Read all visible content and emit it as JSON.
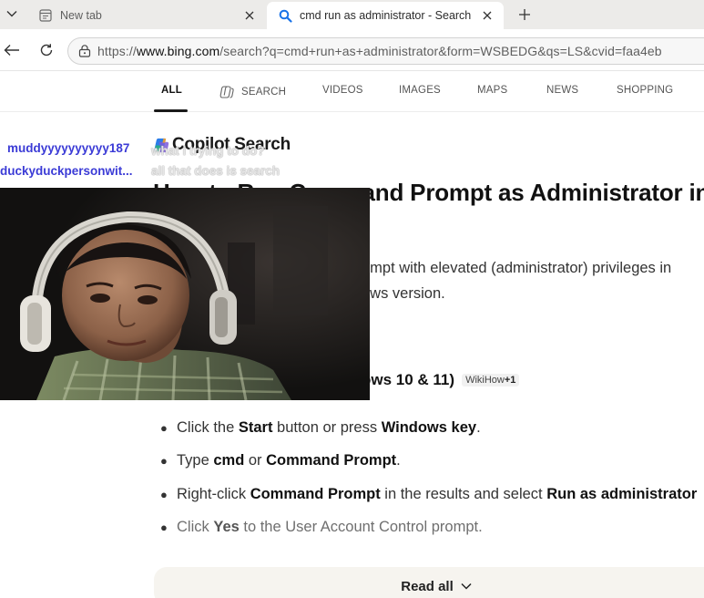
{
  "browser": {
    "tabs": [
      {
        "title": "New tab",
        "active": false
      },
      {
        "title": "cmd run as administrator - Search",
        "active": true
      }
    ],
    "address": {
      "scheme": "https://",
      "domain": "www.bing.com",
      "path": "/search?q=cmd+run+as+administrator&form=WSBEDG&qs=LS&cvid=faa4eb"
    }
  },
  "scopes": [
    {
      "label": "ALL",
      "active": true
    },
    {
      "label": "SEARCH",
      "active": false
    },
    {
      "label": "VIDEOS",
      "active": false
    },
    {
      "label": "IMAGES",
      "active": false
    },
    {
      "label": "MAPS",
      "active": false
    },
    {
      "label": "NEWS",
      "active": false
    },
    {
      "label": "SHOPPING",
      "active": false
    }
  ],
  "copilot": {
    "title": "Copilot Search",
    "headline_line1": "How to Run Command Prompt as Administrator in",
    "summary_line1": "ompt with elevated (administrator) privileges in",
    "summary_line2": "ows version.",
    "subheading": "ows 10 & 11)",
    "badge_source": "WikiHow",
    "badge_count": "+1",
    "steps": [
      {
        "pre": "Click the ",
        "b1": "Start",
        "mid": " button or press ",
        "b2": "Windows key",
        "post": "."
      },
      {
        "pre": "Type ",
        "b1": "cmd",
        "mid": " or ",
        "b2": "Command Prompt",
        "post": "."
      },
      {
        "pre": "Right-click ",
        "b1": "Command Prompt",
        "mid": " in the results and select ",
        "b2": "Run as administrator",
        "post": ""
      },
      {
        "pre": "Click ",
        "b1": "Yes",
        "mid": " to the User Account Control prompt.",
        "b2": "",
        "post": ""
      }
    ],
    "read_all": "Read all"
  },
  "chat": [
    {
      "user": "muddyyyyyyyyyy187",
      "message": "what i trying to do?"
    },
    {
      "user": "duckyduckpersonwit...",
      "message": "all that does is search"
    }
  ],
  "colors": {
    "tabstrip": "#ecebe9",
    "bing_blue": "#1a73e8",
    "chat_username": "#3b3bd6",
    "read_all_bg": "#f6f4ef"
  }
}
